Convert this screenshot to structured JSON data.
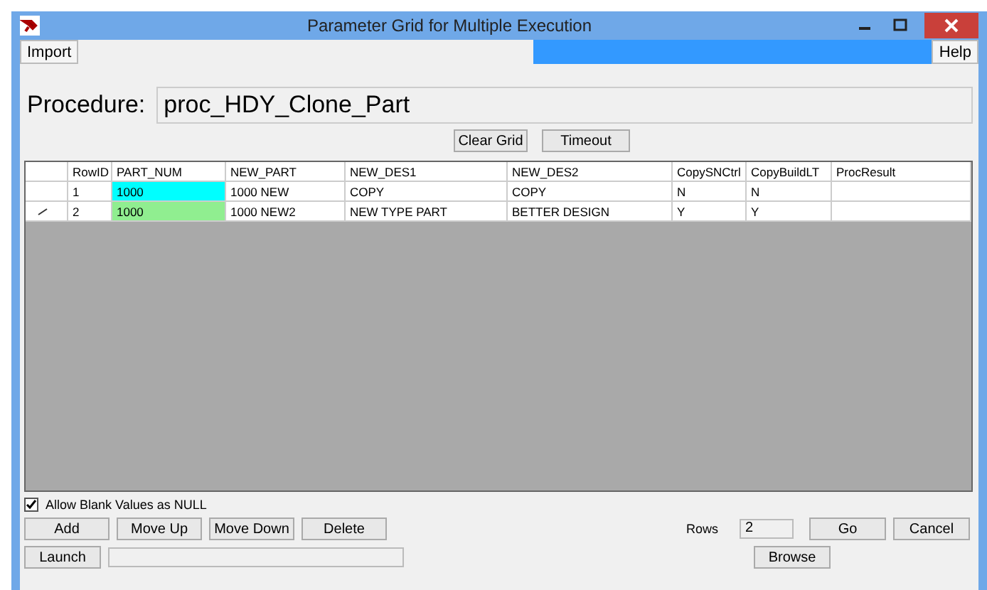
{
  "window": {
    "title": "Parameter Grid for Multiple Execution"
  },
  "menu": {
    "left": "Import",
    "right": "Help"
  },
  "procedure": {
    "label": "Procedure:",
    "value": "proc_HDY_Clone_Part"
  },
  "top_buttons": [
    "Clear Grid",
    "Timeout"
  ],
  "table": {
    "columns": [
      "RowID",
      "PART_NUM",
      "NEW_PART",
      "NEW_DES1",
      "NEW_DES2",
      "CopySNCtrl",
      "CopyBuildLT",
      "ProcResult"
    ],
    "rows": [
      {
        "editing": false,
        "color": "#00ffff",
        "cells": [
          "1",
          "1000",
          "1000 NEW",
          "COPY",
          "COPY",
          "N",
          "N",
          ""
        ]
      },
      {
        "editing": true,
        "color": "#90ee90",
        "cells": [
          "2",
          "1000",
          "1000 NEW2",
          "NEW TYPE PART",
          "BETTER DESIGN",
          "Y",
          "Y",
          ""
        ]
      }
    ]
  },
  "allow_blank": {
    "label": "Allow Blank Values as NULL",
    "checked": true
  },
  "row_buttons": [
    "Add",
    "Move Up",
    "Move Down",
    "Delete"
  ],
  "launch": {
    "button": "Launch"
  },
  "rows_field": {
    "label": "Rows",
    "value": "2"
  },
  "go": "Go",
  "cancel": "Cancel",
  "browse": "Browse"
}
